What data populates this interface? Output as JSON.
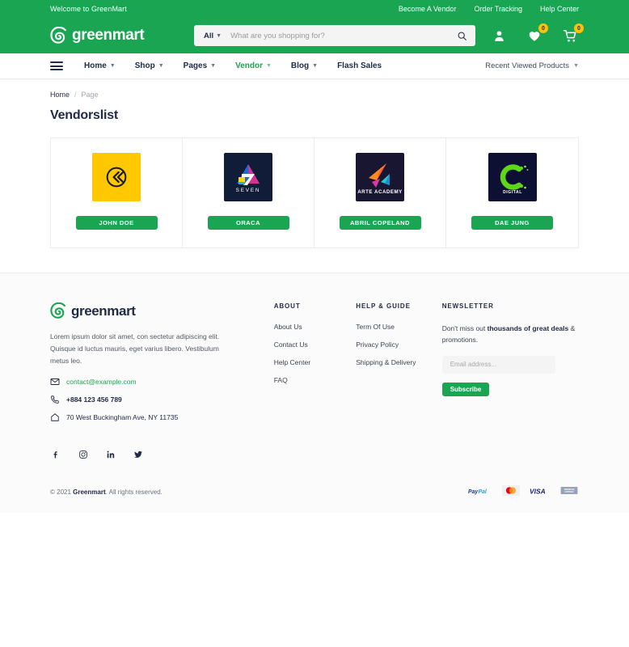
{
  "topbar": {
    "welcome": "Welcome to GreenMart",
    "links": [
      "Become A Vendor",
      "Order Tracking",
      "Help Center"
    ]
  },
  "header": {
    "brand": "greenmart",
    "logo_icon": "greenmart-spiral-icon",
    "search": {
      "category": "All",
      "placeholder": "What are you shopping for?",
      "value": "",
      "search_icon": "search-icon"
    },
    "icons": {
      "account": "user-icon",
      "wishlist": "heart-icon",
      "wishlist_count": "0",
      "cart": "cart-icon",
      "cart_count": "0"
    }
  },
  "nav": {
    "menu_icon": "hamburger-icon",
    "items": [
      {
        "label": "Home",
        "caret": true,
        "active": false
      },
      {
        "label": "Shop",
        "caret": true,
        "active": false
      },
      {
        "label": "Pages",
        "caret": true,
        "active": false
      },
      {
        "label": "Vendor",
        "caret": true,
        "active": true
      },
      {
        "label": "Blog",
        "caret": true,
        "active": false
      },
      {
        "label": "Flash Sales",
        "caret": false,
        "active": false
      }
    ],
    "recent": "Recent Viewed Products"
  },
  "breadcrumb": {
    "home": "Home",
    "separator": "/",
    "current": "Page"
  },
  "page_title": "Vendorslist",
  "vendors": [
    {
      "name": "JOHN DOE",
      "logo_name": "vendor-logo-circle-arrows",
      "bg": "#ffc800",
      "caption": ""
    },
    {
      "name": "ORACA",
      "logo_name": "vendor-logo-seven",
      "bg": "#111c38",
      "caption": "SEVEN"
    },
    {
      "name": "ABRIL COPELAND",
      "logo_name": "vendor-logo-arte-academy",
      "bg": "#191632",
      "caption": "ARTE ACADEMY"
    },
    {
      "name": "DAE JUNG",
      "logo_name": "vendor-logo-digital-c",
      "bg": "#0d1033",
      "caption": "DIGITAL"
    }
  ],
  "footer": {
    "brand": "greenmart",
    "description": "Lorem ipsum dolor sit amet, con sectetur adipiscing elit. Quisque id luctus mauris, eget varius libero. Vestibulum metus leo.",
    "email": "contact@example.com",
    "phone": "+884 123 456 789",
    "address": "70 West Buckingham Ave, NY 11735",
    "columns": [
      {
        "title": "ABOUT",
        "links": [
          "About Us",
          "Contact Us",
          "Help Center",
          "FAQ"
        ]
      },
      {
        "title": "HELP & GUIDE",
        "links": [
          "Term Of Use",
          "Privacy Policy",
          "Shipping & Delivery"
        ]
      }
    ],
    "newsletter": {
      "title": "NEWSLETTER",
      "text_prefix": "Don't miss out ",
      "text_bold": "thousands of great deals",
      "text_suffix": " & promotions.",
      "placeholder": "Email address...",
      "value": "",
      "button": "Subscribe"
    },
    "socials": [
      "facebook-icon",
      "instagram-icon",
      "linkedin-icon",
      "twitter-icon"
    ],
    "copyright_prefix": "© 2021 ",
    "copyright_brand": "Greenmart",
    "copyright_suffix": ". All rights reserved.",
    "payments": [
      "PayPal",
      "Mastercard",
      "VISA",
      "American Express"
    ]
  },
  "colors": {
    "brand_green": "#19a551",
    "badge_yellow": "#ffc107",
    "dark": "#222b45"
  }
}
